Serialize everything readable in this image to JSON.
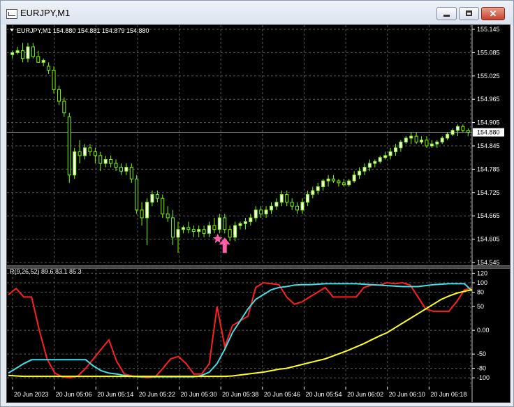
{
  "window": {
    "title": "EURJPY,M1",
    "buttons": [
      "minimize",
      "maximize",
      "close"
    ],
    "close_glyph": "✕"
  },
  "chart": {
    "header": "EURJPY,M1  154.880 154.881 154.879 154.880",
    "current_price": "154.880",
    "price_ticks": [
      "155.145",
      "155.085",
      "155.025",
      "154.965",
      "154.905",
      "154.845",
      "154.785",
      "154.725",
      "154.665",
      "154.605",
      "154.545"
    ],
    "price_range": [
      154.545,
      155.145
    ],
    "up_color": "#7cfc00",
    "wick_color": "#7cfc00",
    "candles_ohlc": [
      [
        155.08,
        155.09,
        155.07,
        155.085
      ],
      [
        155.085,
        155.1,
        155.08,
        155.09
      ],
      [
        155.09,
        155.11,
        155.06,
        155.07
      ],
      [
        155.07,
        155.11,
        155.06,
        155.1
      ],
      [
        155.1,
        155.11,
        155.07,
        155.075
      ],
      [
        155.075,
        155.09,
        155.06,
        155.06
      ],
      [
        155.06,
        155.07,
        155.05,
        155.065
      ],
      [
        155.05,
        155.06,
        155.03,
        155.04
      ],
      [
        155.04,
        155.05,
        154.98,
        154.99
      ],
      [
        154.99,
        155.0,
        154.95,
        154.96
      ],
      [
        154.96,
        154.97,
        154.92,
        154.93
      ],
      [
        154.92,
        154.93,
        154.75,
        154.77
      ],
      [
        154.77,
        154.84,
        154.76,
        154.83
      ],
      [
        154.83,
        154.86,
        154.8,
        154.82
      ],
      [
        154.82,
        154.85,
        154.81,
        154.84
      ],
      [
        154.84,
        154.85,
        154.82,
        154.83
      ],
      [
        154.83,
        154.84,
        154.8,
        154.82
      ],
      [
        154.82,
        154.83,
        154.78,
        154.8
      ],
      [
        154.8,
        154.82,
        154.79,
        154.81
      ],
      [
        154.81,
        154.82,
        154.79,
        154.8
      ],
      [
        154.8,
        154.81,
        154.78,
        154.79
      ],
      [
        154.79,
        154.8,
        154.77,
        154.78
      ],
      [
        154.78,
        154.8,
        154.77,
        154.79
      ],
      [
        154.79,
        154.8,
        154.75,
        154.76
      ],
      [
        154.76,
        154.77,
        154.67,
        154.68
      ],
      [
        154.68,
        154.7,
        154.64,
        154.66
      ],
      [
        154.66,
        154.71,
        154.59,
        154.7
      ],
      [
        154.7,
        154.73,
        154.69,
        154.72
      ],
      [
        154.72,
        154.73,
        154.7,
        154.71
      ],
      [
        154.71,
        154.72,
        154.66,
        154.67
      ],
      [
        154.67,
        154.69,
        154.65,
        154.66
      ],
      [
        154.66,
        154.68,
        154.59,
        154.61
      ],
      [
        154.61,
        154.65,
        154.57,
        154.63
      ],
      [
        154.63,
        154.64,
        154.62,
        154.635
      ],
      [
        154.635,
        154.65,
        154.62,
        154.63
      ],
      [
        154.63,
        154.64,
        154.61,
        154.625
      ],
      [
        154.625,
        154.64,
        154.61,
        154.63
      ],
      [
        154.63,
        154.64,
        154.61,
        154.62
      ],
      [
        154.62,
        154.65,
        154.61,
        154.64
      ],
      [
        154.64,
        154.66,
        154.62,
        154.63
      ],
      [
        154.63,
        154.67,
        154.62,
        154.66
      ],
      [
        154.66,
        154.67,
        154.62,
        154.63
      ],
      [
        154.63,
        154.64,
        154.6,
        154.61
      ],
      [
        154.61,
        154.65,
        154.6,
        154.64
      ],
      [
        154.64,
        154.65,
        154.63,
        154.645
      ],
      [
        154.645,
        154.66,
        154.63,
        154.65
      ],
      [
        154.65,
        154.67,
        154.64,
        154.66
      ],
      [
        154.66,
        154.69,
        154.65,
        154.68
      ],
      [
        154.68,
        154.69,
        154.66,
        154.67
      ],
      [
        154.67,
        154.69,
        154.66,
        154.68
      ],
      [
        154.68,
        154.7,
        154.67,
        154.69
      ],
      [
        154.69,
        154.71,
        154.68,
        154.7
      ],
      [
        154.7,
        154.73,
        154.69,
        154.72
      ],
      [
        154.72,
        154.73,
        154.69,
        154.7
      ],
      [
        154.7,
        154.71,
        154.68,
        154.69
      ],
      [
        154.69,
        154.7,
        154.67,
        154.68
      ],
      [
        154.68,
        154.71,
        154.67,
        154.7
      ],
      [
        154.7,
        154.73,
        154.69,
        154.72
      ],
      [
        154.72,
        154.74,
        154.71,
        154.73
      ],
      [
        154.73,
        154.75,
        154.72,
        154.74
      ],
      [
        154.74,
        154.76,
        154.73,
        154.755
      ],
      [
        154.755,
        154.77,
        154.74,
        154.76
      ],
      [
        154.76,
        154.77,
        154.75,
        154.755
      ],
      [
        154.755,
        154.76,
        154.74,
        154.75
      ],
      [
        154.75,
        154.76,
        154.74,
        154.745
      ],
      [
        154.745,
        154.76,
        154.74,
        154.755
      ],
      [
        154.755,
        154.78,
        154.75,
        154.77
      ],
      [
        154.77,
        154.79,
        154.76,
        154.78
      ],
      [
        154.78,
        154.8,
        154.77,
        154.79
      ],
      [
        154.79,
        154.81,
        154.78,
        154.8
      ],
      [
        154.8,
        154.81,
        154.79,
        154.805
      ],
      [
        154.805,
        154.82,
        154.8,
        154.815
      ],
      [
        154.815,
        154.83,
        154.81,
        154.82
      ],
      [
        154.82,
        154.84,
        154.81,
        154.83
      ],
      [
        154.83,
        154.85,
        154.82,
        154.84
      ],
      [
        154.84,
        154.86,
        154.83,
        154.855
      ],
      [
        154.855,
        154.87,
        154.85,
        154.865
      ],
      [
        154.865,
        154.88,
        154.85,
        154.87
      ],
      [
        154.87,
        154.88,
        154.85,
        154.855
      ],
      [
        154.855,
        154.87,
        154.85,
        154.86
      ],
      [
        154.86,
        154.87,
        154.84,
        154.845
      ],
      [
        154.845,
        154.86,
        154.84,
        154.85
      ],
      [
        154.85,
        154.86,
        154.84,
        154.855
      ],
      [
        154.855,
        154.87,
        154.85,
        154.865
      ],
      [
        154.865,
        154.88,
        154.86,
        154.875
      ],
      [
        154.875,
        154.89,
        154.87,
        154.885
      ],
      [
        154.885,
        154.9,
        154.87,
        154.895
      ],
      [
        154.895,
        154.9,
        154.88,
        154.885
      ],
      [
        154.885,
        154.89,
        154.87,
        154.88
      ]
    ],
    "marker_color": "#ff5fa8",
    "marker_candle_index": 41
  },
  "indicator": {
    "header": "R(9,26,52) 89.6 83.1 85.3",
    "ticks": [
      "120",
      "100",
      "80",
      "50",
      "0.00",
      "-50",
      "-80",
      "-100"
    ],
    "range": [
      -110,
      125
    ],
    "series": [
      {
        "color": "#ff2020",
        "values": [
          75,
          88,
          70,
          70,
          0,
          -60,
          -90,
          -98,
          -100,
          -96,
          -80,
          -60,
          -40,
          -20,
          -65,
          -92,
          -96,
          -98,
          -100,
          -98,
          -80,
          -60,
          -55,
          -70,
          -92,
          -92,
          -70,
          50,
          -35,
          10,
          20,
          30,
          90,
          100,
          98,
          96,
          70,
          55,
          60,
          70,
          80,
          90,
          70,
          70,
          70,
          70,
          90,
          95,
          95,
          100,
          98,
          100,
          95,
          70,
          45,
          40,
          40,
          40,
          60,
          85,
          89.6
        ]
      },
      {
        "color": "#40e0e8",
        "values": [
          -90,
          -80,
          -70,
          -62,
          -62,
          -62,
          -62,
          -62,
          -62,
          -62,
          -62,
          -75,
          -85,
          -90,
          -92,
          -95,
          -97,
          -98,
          -98,
          -98,
          -98,
          -98,
          -98,
          -98,
          -98,
          -95,
          -88,
          -70,
          -40,
          -5,
          20,
          45,
          65,
          75,
          85,
          90,
          92,
          95,
          96,
          96,
          97,
          98,
          98,
          98,
          98,
          98,
          97,
          96,
          95,
          94,
          93,
          92,
          92,
          92,
          94,
          96,
          97,
          98,
          98,
          98,
          83.1
        ]
      },
      {
        "color": "#ffff20",
        "values": [
          -95,
          -96,
          -97,
          -97,
          -97,
          -97,
          -97,
          -97,
          -97,
          -97,
          -97,
          -97,
          -97,
          -97,
          -97,
          -97,
          -97,
          -97,
          -97,
          -97,
          -97,
          -97,
          -97,
          -97,
          -97,
          -97,
          -97,
          -97,
          -97,
          -96,
          -94,
          -92,
          -90,
          -88,
          -85,
          -82,
          -80,
          -76,
          -72,
          -68,
          -64,
          -60,
          -54,
          -48,
          -42,
          -35,
          -28,
          -20,
          -12,
          -5,
          5,
          15,
          25,
          35,
          45,
          55,
          65,
          72,
          78,
          82,
          85.3
        ]
      }
    ]
  },
  "time_labels": [
    "20 Jun 2023",
    "20 Jun 05:06",
    "20 Jun 05:14",
    "20 Jun 05:22",
    "20 Jun 05:30",
    "20 Jun 05:38",
    "20 Jun 05:46",
    "20 Jun 05:54",
    "20 Jun 06:02",
    "20 Jun 06:10",
    "20 Jun 06:18"
  ]
}
